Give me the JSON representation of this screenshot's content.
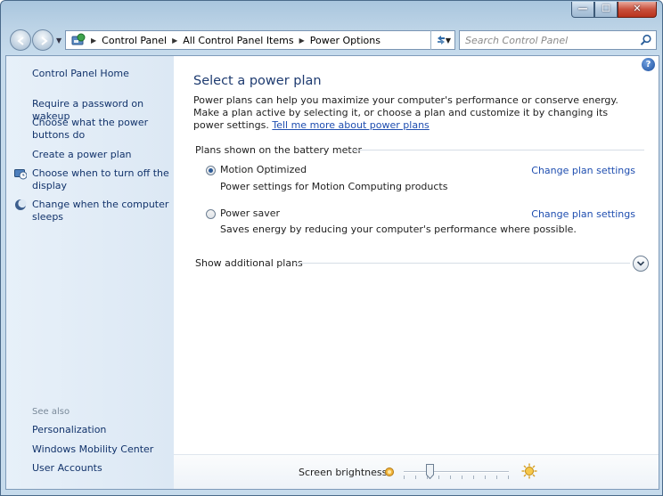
{
  "window": {
    "caption_minimize": "—",
    "caption_maximize": "☐",
    "caption_close": "✕"
  },
  "address": {
    "crumbs": [
      "Control Panel",
      "All Control Panel Items",
      "Power Options"
    ],
    "search_placeholder": "Search Control Panel"
  },
  "sidebar": {
    "home": "Control Panel Home",
    "links": [
      "Require a password on wakeup",
      "Choose what the power buttons do",
      "Create a power plan",
      "Choose when to turn off the display",
      "Change when the computer sleeps"
    ],
    "see_also_label": "See also",
    "see_also": [
      "Personalization",
      "Windows Mobility Center",
      "User Accounts"
    ]
  },
  "main": {
    "help": "?",
    "title": "Select a power plan",
    "intro": "Power plans can help you maximize your computer's performance or conserve energy. Make a plan active by selecting it, or choose a plan and customize it by changing its power settings.",
    "intro_link": "Tell me more about power plans",
    "section_header": "Plans shown on the battery meter",
    "plans": [
      {
        "name": "Motion Optimized",
        "description": "Power settings for Motion Computing products",
        "link": "Change plan settings",
        "selected": true
      },
      {
        "name": "Power saver",
        "description": "Saves energy by reducing your computer's performance where possible.",
        "link": "Change plan settings",
        "selected": false
      }
    ],
    "additional_plans": "Show additional plans"
  },
  "brightness": {
    "label": "Screen brightness:",
    "level": 0.25
  },
  "colors": {
    "link": "#1f4eb0",
    "title": "#1e3b70",
    "sidebar_link": "#12336b",
    "sidebar_bg": "#e3edf7"
  }
}
